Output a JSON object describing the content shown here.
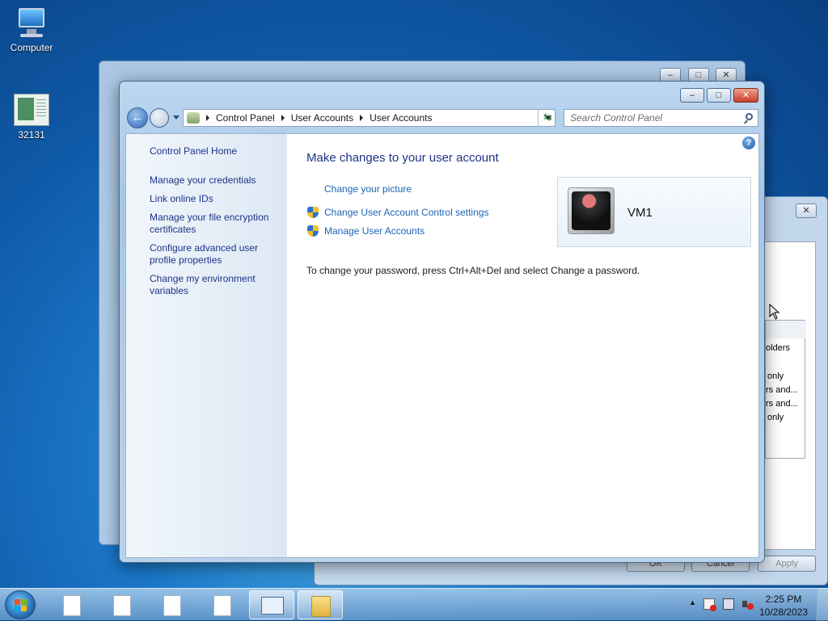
{
  "desktop": {
    "icons": [
      {
        "label": "Computer",
        "icon": "computer-icon"
      },
      {
        "label": "32131",
        "icon": "document-icon"
      }
    ]
  },
  "background_windows": {
    "properties_dialog": {
      "visible_fragments": [
        "olders",
        "only",
        "rs and...",
        "rs and...",
        "only"
      ],
      "buttons": {
        "ok": "OK",
        "cancel": "Cancel",
        "apply": "Apply"
      }
    }
  },
  "window": {
    "caption_buttons": {
      "minimize": "–",
      "maximize": "□",
      "close": "✕"
    },
    "address": {
      "crumbs": [
        "Control Panel",
        "User Accounts",
        "User Accounts"
      ]
    },
    "search": {
      "placeholder": "Search Control Panel"
    },
    "help": "?",
    "left_pane": {
      "home": "Control Panel Home",
      "links": [
        "Manage your credentials",
        "Link online IDs",
        "Manage your file encryption certificates",
        "Configure advanced user profile properties",
        "Change my environment variables"
      ]
    },
    "main": {
      "heading": "Make changes to your user account",
      "tasks": [
        {
          "label": "Change your picture",
          "shield": false
        },
        {
          "label": "Change User Account Control settings",
          "shield": true
        },
        {
          "label": "Manage User Accounts",
          "shield": true
        }
      ],
      "note": "To change your password, press Ctrl+Alt+Del and select Change a password.",
      "user": {
        "name": "VM1"
      }
    }
  },
  "taskbar": {
    "items": [
      "document-icon",
      "document-icon",
      "document-icon",
      "document-icon",
      "control-panel-icon",
      "folder-icon"
    ],
    "tray": {
      "show_hidden": "▲",
      "time": "2:25 PM",
      "date": "10/28/2023"
    }
  },
  "colors": {
    "link": "#1d64b8",
    "heading": "#1e3287",
    "window_frame": "#a7c7e6"
  }
}
